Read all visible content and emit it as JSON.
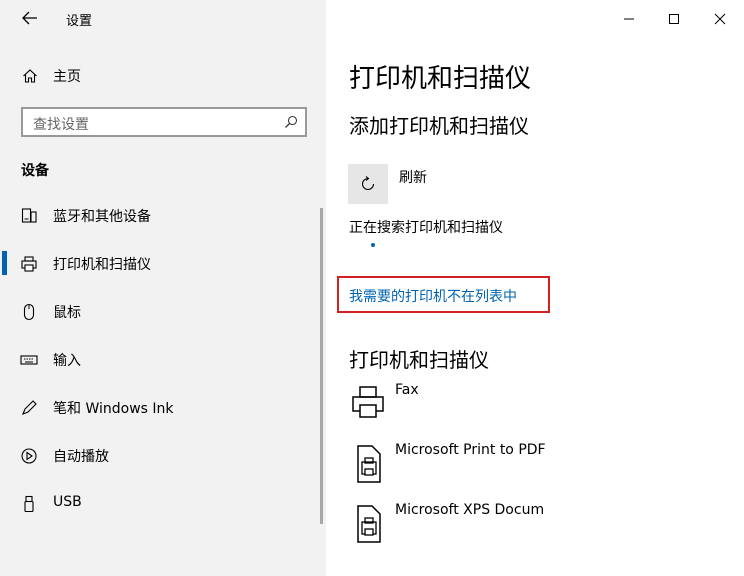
{
  "window": {
    "app_title": "设置"
  },
  "sidebar": {
    "home_label": "主页",
    "search_placeholder": "查找设置",
    "section_title": "设备",
    "items": [
      {
        "label": "蓝牙和其他设备",
        "icon": "bluetooth-devices-icon"
      },
      {
        "label": "打印机和扫描仪",
        "icon": "printer-icon",
        "active": true
      },
      {
        "label": "鼠标",
        "icon": "mouse-icon"
      },
      {
        "label": "输入",
        "icon": "keyboard-icon"
      },
      {
        "label": "笔和 Windows Ink",
        "icon": "pen-icon"
      },
      {
        "label": "自动播放",
        "icon": "autoplay-icon"
      },
      {
        "label": "USB",
        "icon": "usb-icon"
      }
    ]
  },
  "main": {
    "page_title": "打印机和扫描仪",
    "add_section_title": "添加打印机和扫描仪",
    "refresh_label": "刷新",
    "searching_text": "正在搜索打印机和扫描仪",
    "missing_printer_link": "我需要的打印机不在列表中",
    "printers_section_title": "打印机和扫描仪",
    "printers": [
      {
        "name": "Fax",
        "icon": "fax-printer-icon"
      },
      {
        "name": "Microsoft Print to PDF",
        "icon": "document-printer-icon"
      },
      {
        "name": "Microsoft XPS Docum",
        "icon": "document-printer-icon"
      }
    ]
  },
  "colors": {
    "accent": "#0063b1",
    "highlight_border": "#d32121",
    "sidebar_bg": "#f2f2f2"
  }
}
